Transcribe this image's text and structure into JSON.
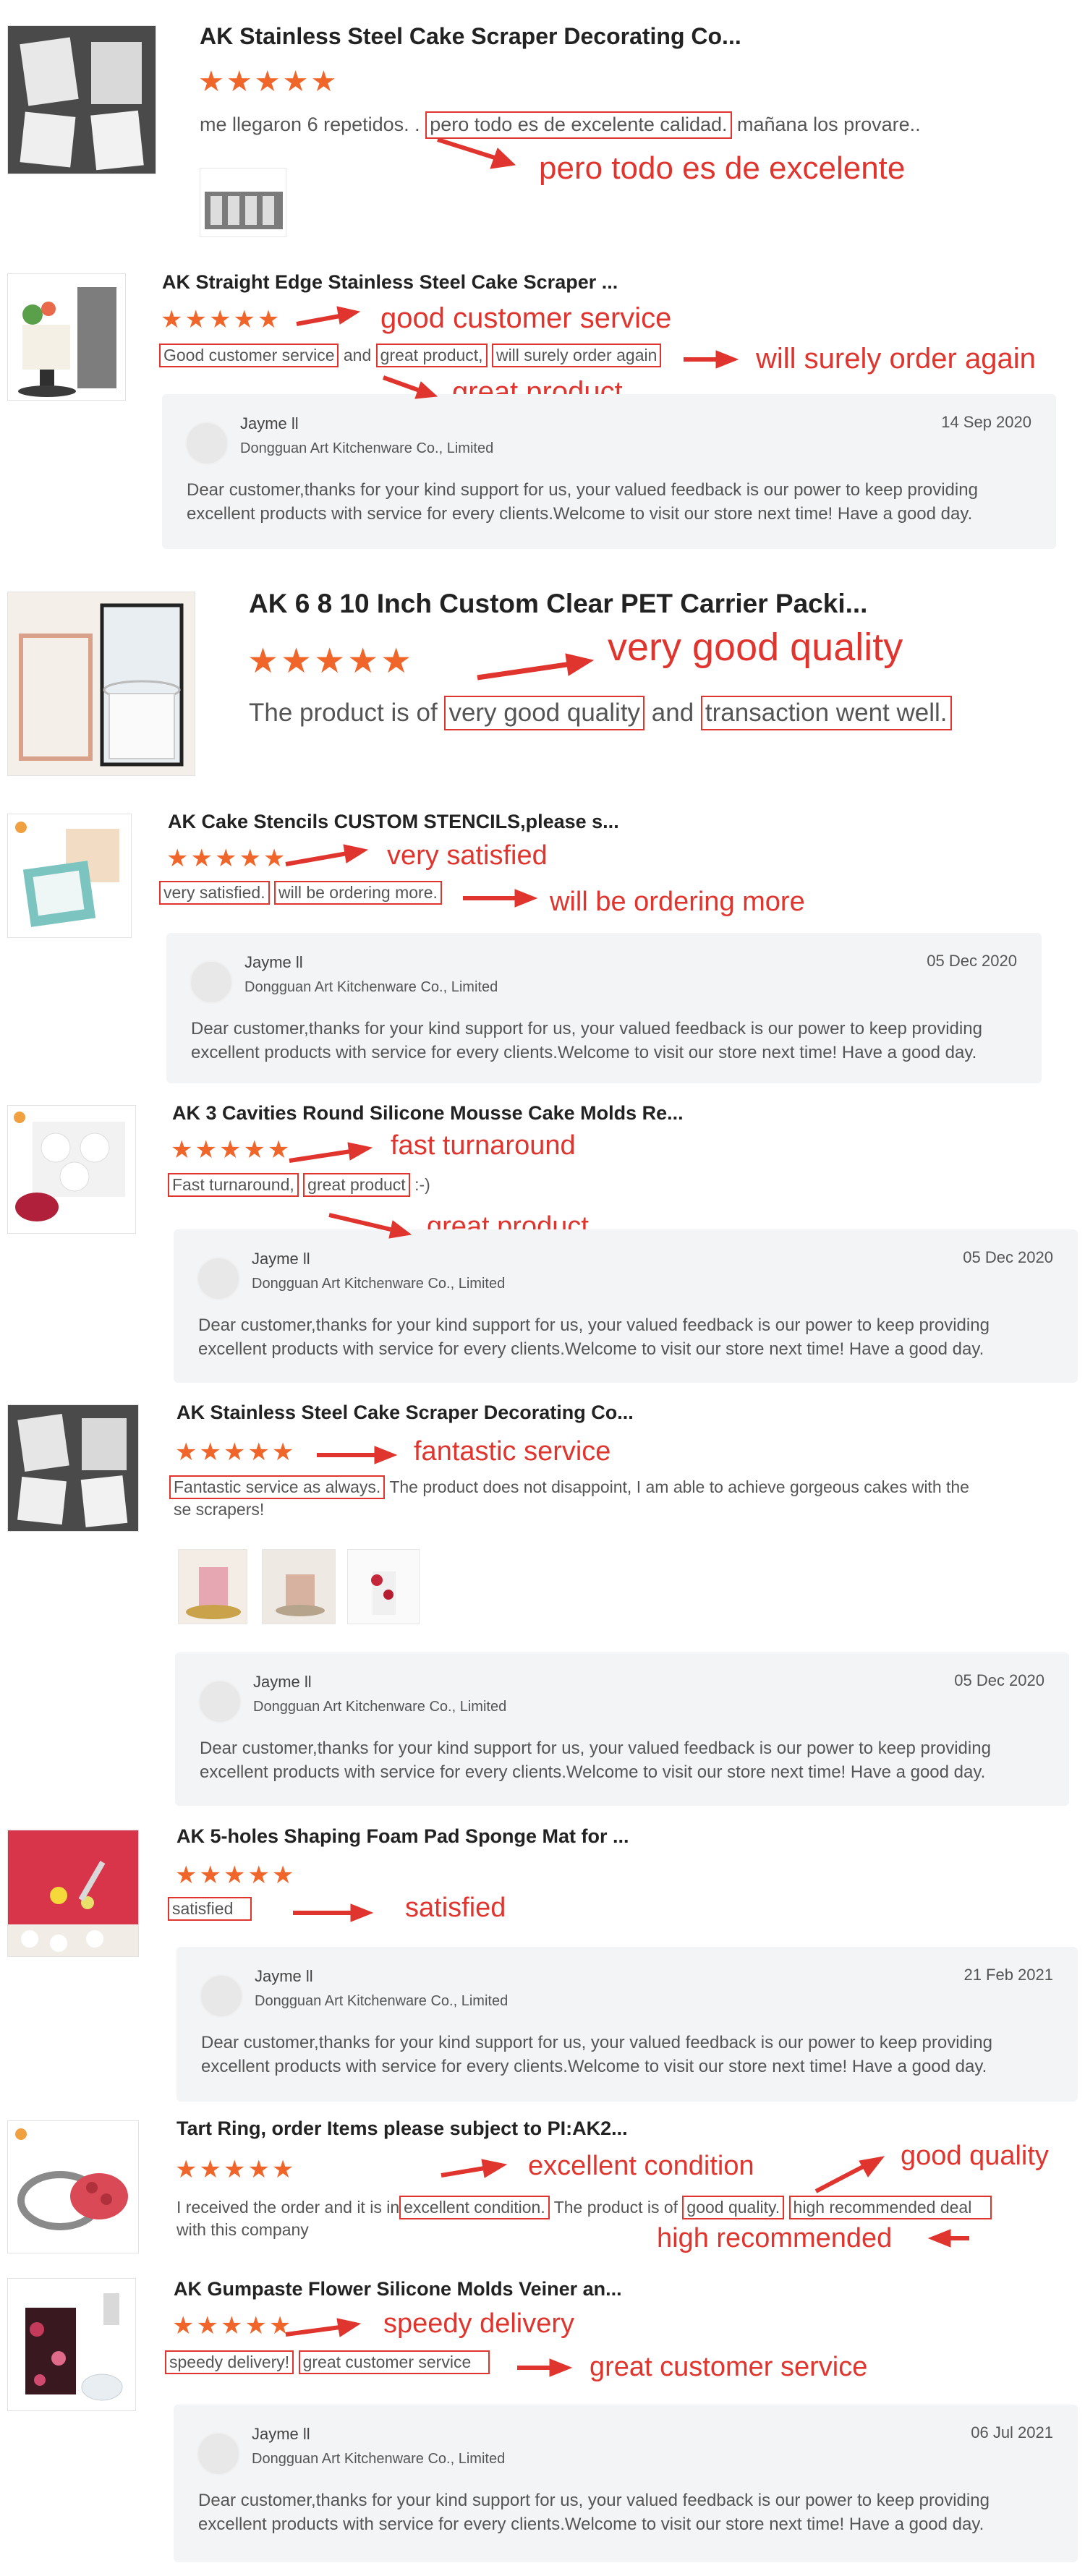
{
  "accent_color": "#e0352e",
  "star_color": "#f0652a",
  "reply": {
    "name": "Jayme ll",
    "company": "Dongguan Art Kitchenware Co., Limited",
    "text": "Dear customer,thanks for your kind support for us, your valued feedback is our power to keep providing excellent products with service for every clients.Welcome to visit our store next time! Have a good day."
  },
  "reviews": [
    {
      "title": "AK Stainless Steel Cake Scraper Decorating Co...",
      "stars": "★★★★★",
      "text_a": "me llegaron 6 repetidos. .",
      "highlight_a": "pero todo es de excelente calidad.",
      "text_b": "mañana los provare..",
      "annotation_1": "pero todo es de excelente"
    },
    {
      "title": "AK Straight Edge Stainless Steel Cake Scraper ...",
      "stars": "★★★★★",
      "highlight_a": "Good customer service",
      "text_a": "and",
      "highlight_b": "great product,",
      "highlight_c": "will surely order again",
      "annotation_1": "good customer service",
      "annotation_2": "will surely order again",
      "annotation_3": "great product",
      "reply_date": "14 Sep 2020"
    },
    {
      "title": "AK 6 8 10 Inch Custom Clear PET Carrier Packi...",
      "stars": "★★★★★",
      "text_a": "The product is of",
      "highlight_a": "very good quality",
      "text_b": "and",
      "highlight_b": "transaction went well.",
      "annotation_1": "very good quality"
    },
    {
      "title": "AK Cake Stencils CUSTOM STENCILS,please s...",
      "stars": "★★★★★",
      "highlight_a": "very satisfied.",
      "highlight_b": "will be ordering more.",
      "annotation_1": "very satisfied",
      "annotation_2": "will be ordering more",
      "reply_date": "05 Dec 2020"
    },
    {
      "title": "AK 3 Cavities Round Silicone Mousse Cake Molds Re...",
      "stars": "★★★★★",
      "highlight_a": "Fast turnaround,",
      "highlight_b": "great product",
      "text_a": ":-)",
      "annotation_1": "fast turnaround",
      "annotation_2": "great product",
      "reply_date": "05 Dec 2020"
    },
    {
      "title": "AK Stainless Steel Cake Scraper Decorating Co...",
      "stars": "★★★★★",
      "highlight_a": "Fantastic service as always.",
      "text_a": "The product does not disappoint, I am able to achieve gorgeous cakes with the",
      "text_b": "se scrapers!",
      "annotation_1": "fantastic service",
      "reply_date": "05 Dec 2020"
    },
    {
      "title": "AK 5-holes Shaping Foam Pad Sponge Mat for ...",
      "stars": "★★★★★",
      "highlight_a": "satisfied",
      "annotation_1": "satisfied",
      "reply_date": "21 Feb 2021"
    },
    {
      "title": "Tart Ring, order Items please subject to PI:AK2...",
      "stars": "★★★★★",
      "text_a": "I received the order and it is in",
      "highlight_a": "excellent condition.",
      "text_b": "The product is of",
      "highlight_b": "good quality.",
      "highlight_c": "high recommended deal",
      "text_c": "with this company",
      "annotation_1": "excellent condition",
      "annotation_2": "good quality",
      "annotation_3": "high recommended"
    },
    {
      "title": "AK Gumpaste Flower Silicone Molds Veiner an...",
      "stars": "★★★★★",
      "highlight_a": "speedy delivery!",
      "highlight_b": "great customer service",
      "annotation_1": "speedy delivery",
      "annotation_2": "great customer service",
      "reply_date": "06 Jul 2021"
    }
  ]
}
